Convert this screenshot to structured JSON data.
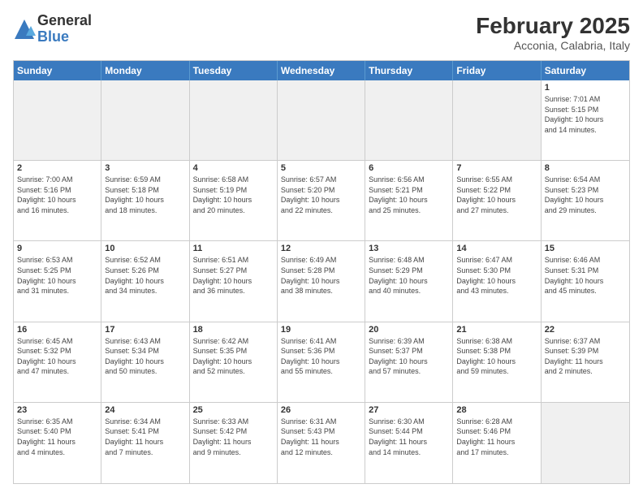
{
  "logo": {
    "general": "General",
    "blue": "Blue"
  },
  "header": {
    "month": "February 2025",
    "location": "Acconia, Calabria, Italy"
  },
  "days": [
    "Sunday",
    "Monday",
    "Tuesday",
    "Wednesday",
    "Thursday",
    "Friday",
    "Saturday"
  ],
  "weeks": [
    [
      {
        "day": "",
        "text": ""
      },
      {
        "day": "",
        "text": ""
      },
      {
        "day": "",
        "text": ""
      },
      {
        "day": "",
        "text": ""
      },
      {
        "day": "",
        "text": ""
      },
      {
        "day": "",
        "text": ""
      },
      {
        "day": "1",
        "text": "Sunrise: 7:01 AM\nSunset: 5:15 PM\nDaylight: 10 hours\nand 14 minutes."
      }
    ],
    [
      {
        "day": "2",
        "text": "Sunrise: 7:00 AM\nSunset: 5:16 PM\nDaylight: 10 hours\nand 16 minutes."
      },
      {
        "day": "3",
        "text": "Sunrise: 6:59 AM\nSunset: 5:18 PM\nDaylight: 10 hours\nand 18 minutes."
      },
      {
        "day": "4",
        "text": "Sunrise: 6:58 AM\nSunset: 5:19 PM\nDaylight: 10 hours\nand 20 minutes."
      },
      {
        "day": "5",
        "text": "Sunrise: 6:57 AM\nSunset: 5:20 PM\nDaylight: 10 hours\nand 22 minutes."
      },
      {
        "day": "6",
        "text": "Sunrise: 6:56 AM\nSunset: 5:21 PM\nDaylight: 10 hours\nand 25 minutes."
      },
      {
        "day": "7",
        "text": "Sunrise: 6:55 AM\nSunset: 5:22 PM\nDaylight: 10 hours\nand 27 minutes."
      },
      {
        "day": "8",
        "text": "Sunrise: 6:54 AM\nSunset: 5:23 PM\nDaylight: 10 hours\nand 29 minutes."
      }
    ],
    [
      {
        "day": "9",
        "text": "Sunrise: 6:53 AM\nSunset: 5:25 PM\nDaylight: 10 hours\nand 31 minutes."
      },
      {
        "day": "10",
        "text": "Sunrise: 6:52 AM\nSunset: 5:26 PM\nDaylight: 10 hours\nand 34 minutes."
      },
      {
        "day": "11",
        "text": "Sunrise: 6:51 AM\nSunset: 5:27 PM\nDaylight: 10 hours\nand 36 minutes."
      },
      {
        "day": "12",
        "text": "Sunrise: 6:49 AM\nSunset: 5:28 PM\nDaylight: 10 hours\nand 38 minutes."
      },
      {
        "day": "13",
        "text": "Sunrise: 6:48 AM\nSunset: 5:29 PM\nDaylight: 10 hours\nand 40 minutes."
      },
      {
        "day": "14",
        "text": "Sunrise: 6:47 AM\nSunset: 5:30 PM\nDaylight: 10 hours\nand 43 minutes."
      },
      {
        "day": "15",
        "text": "Sunrise: 6:46 AM\nSunset: 5:31 PM\nDaylight: 10 hours\nand 45 minutes."
      }
    ],
    [
      {
        "day": "16",
        "text": "Sunrise: 6:45 AM\nSunset: 5:32 PM\nDaylight: 10 hours\nand 47 minutes."
      },
      {
        "day": "17",
        "text": "Sunrise: 6:43 AM\nSunset: 5:34 PM\nDaylight: 10 hours\nand 50 minutes."
      },
      {
        "day": "18",
        "text": "Sunrise: 6:42 AM\nSunset: 5:35 PM\nDaylight: 10 hours\nand 52 minutes."
      },
      {
        "day": "19",
        "text": "Sunrise: 6:41 AM\nSunset: 5:36 PM\nDaylight: 10 hours\nand 55 minutes."
      },
      {
        "day": "20",
        "text": "Sunrise: 6:39 AM\nSunset: 5:37 PM\nDaylight: 10 hours\nand 57 minutes."
      },
      {
        "day": "21",
        "text": "Sunrise: 6:38 AM\nSunset: 5:38 PM\nDaylight: 10 hours\nand 59 minutes."
      },
      {
        "day": "22",
        "text": "Sunrise: 6:37 AM\nSunset: 5:39 PM\nDaylight: 11 hours\nand 2 minutes."
      }
    ],
    [
      {
        "day": "23",
        "text": "Sunrise: 6:35 AM\nSunset: 5:40 PM\nDaylight: 11 hours\nand 4 minutes."
      },
      {
        "day": "24",
        "text": "Sunrise: 6:34 AM\nSunset: 5:41 PM\nDaylight: 11 hours\nand 7 minutes."
      },
      {
        "day": "25",
        "text": "Sunrise: 6:33 AM\nSunset: 5:42 PM\nDaylight: 11 hours\nand 9 minutes."
      },
      {
        "day": "26",
        "text": "Sunrise: 6:31 AM\nSunset: 5:43 PM\nDaylight: 11 hours\nand 12 minutes."
      },
      {
        "day": "27",
        "text": "Sunrise: 6:30 AM\nSunset: 5:44 PM\nDaylight: 11 hours\nand 14 minutes."
      },
      {
        "day": "28",
        "text": "Sunrise: 6:28 AM\nSunset: 5:46 PM\nDaylight: 11 hours\nand 17 minutes."
      },
      {
        "day": "",
        "text": ""
      }
    ]
  ]
}
